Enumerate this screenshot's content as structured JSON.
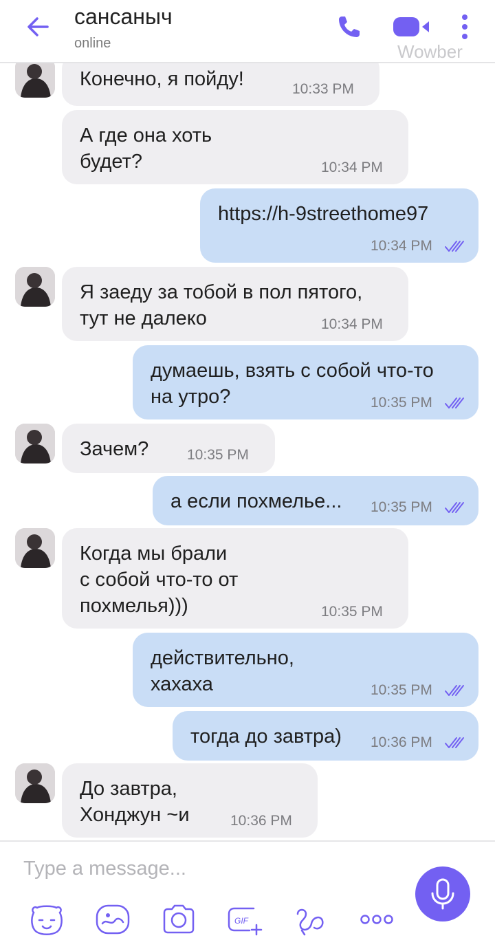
{
  "header": {
    "contact_name": "сансаныч",
    "status": "online",
    "watermark": "Wowber"
  },
  "colors": {
    "accent": "#7360f2",
    "incoming_bubble": "#efeef1",
    "outgoing_bubble": "#c9ddf6"
  },
  "messages": [
    {
      "direction": "in",
      "lines": [
        "Конечно, я пойду!"
      ],
      "time": "10:33 PM"
    },
    {
      "direction": "in",
      "lines": [
        "А где она хоть",
        "будет?"
      ],
      "time": "10:34 PM"
    },
    {
      "direction": "out",
      "lines": [
        "https://h-9streethome97"
      ],
      "time": "10:34 PM",
      "read": true
    },
    {
      "direction": "in",
      "lines": [
        "Я заеду за тобой в пол пятого,",
        "тут не далеко"
      ],
      "time": "10:34 PM"
    },
    {
      "direction": "out",
      "lines": [
        "думаешь, взять с собой что-то",
        "на утро?"
      ],
      "time": "10:35 PM",
      "read": true
    },
    {
      "direction": "in",
      "lines": [
        "Зачем?"
      ],
      "time": "10:35 PM"
    },
    {
      "direction": "out",
      "lines": [
        "а если похмелье..."
      ],
      "time": "10:35 PM",
      "read": true
    },
    {
      "direction": "in",
      "lines": [
        "Когда мы брали",
        "с собой что-то от",
        "похмелья)))"
      ],
      "time": "10:35 PM"
    },
    {
      "direction": "out",
      "lines": [
        "действительно,",
        "хахаха"
      ],
      "time": "10:35 PM",
      "read": true
    },
    {
      "direction": "out",
      "lines": [
        "тогда до завтра)"
      ],
      "time": "10:36 PM",
      "read": true
    },
    {
      "direction": "in",
      "lines": [
        "До завтра,",
        "Хонджун ~и"
      ],
      "time": "10:36 PM"
    }
  ],
  "composer": {
    "placeholder": "Type a message...",
    "tools": [
      "sticker-icon",
      "doodle-icon",
      "camera-icon",
      "gif-icon",
      "scribble-icon",
      "more-options-icon"
    ],
    "gif_label": "GIF"
  }
}
